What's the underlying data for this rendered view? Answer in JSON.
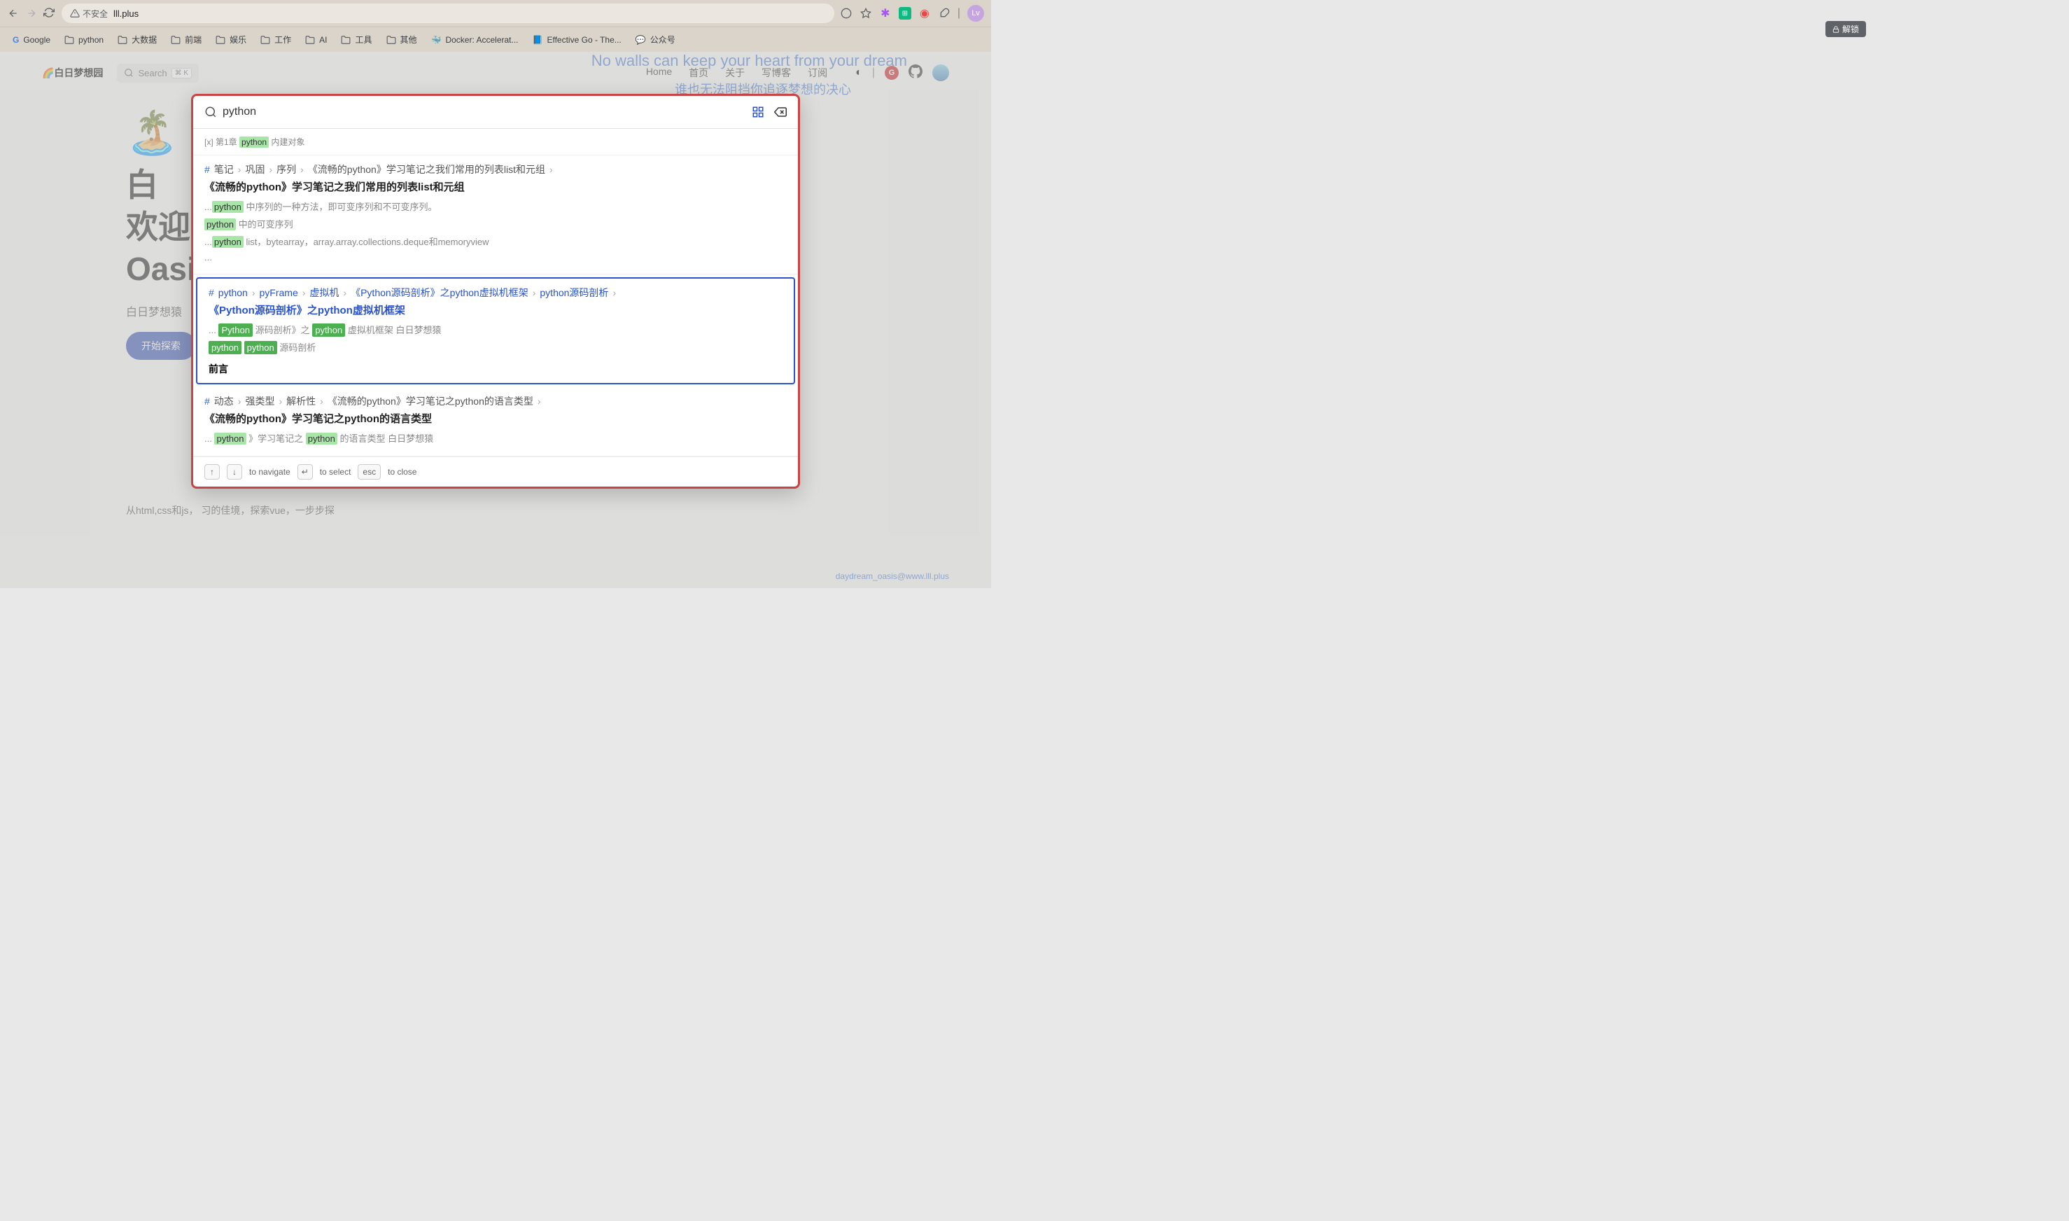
{
  "browser": {
    "insecure_label": "不安全",
    "url": "lll.plus",
    "lock_badge": "解锁",
    "avatar_letter": "Lv"
  },
  "bookmarks": [
    {
      "icon": "google",
      "label": "Google"
    },
    {
      "icon": "folder",
      "label": "python"
    },
    {
      "icon": "folder",
      "label": "大数据"
    },
    {
      "icon": "folder",
      "label": "前端"
    },
    {
      "icon": "folder",
      "label": "娱乐"
    },
    {
      "icon": "folder",
      "label": "工作"
    },
    {
      "icon": "folder",
      "label": "AI"
    },
    {
      "icon": "folder",
      "label": "工具"
    },
    {
      "icon": "folder",
      "label": "其他"
    },
    {
      "icon": "docker",
      "label": "Docker: Accelerat..."
    },
    {
      "icon": "gopher",
      "label": "Effective Go - The..."
    },
    {
      "icon": "wechat",
      "label": "公众号"
    }
  ],
  "nav": {
    "brand": "🌈白日梦想园",
    "search_label": "Search",
    "search_kbd": "⌘ K",
    "links": [
      "Home",
      "首页",
      "关于",
      "写博客",
      "订阅"
    ]
  },
  "hero": {
    "title_line1": "白",
    "title_line2": "欢迎",
    "title_line3": "Oasi",
    "subtitle": "白日梦想猿",
    "button": "开始探索"
  },
  "overlay_text": {
    "line1": "No walls can keep your heart from your dream",
    "line2": "谁也无法阻挡你追逐梦想的决心"
  },
  "body_paragraph": "从html,css和js，                                                                                                                                                                                                                                                     习的佳境，探索vue，一步步探",
  "footer_link": "daydream_oasis@www.lll.plus",
  "search_modal": {
    "query": "python",
    "results": [
      {
        "type": "compact",
        "prefix": "[x] 第1章",
        "highlight": "python",
        "suffix": "内建对象"
      },
      {
        "type": "full",
        "breadcrumb": [
          "笔记",
          "巩固",
          "序列",
          "《流畅的python》学习笔记之我们常用的列表list和元组"
        ],
        "title": "《流畅的python》学习笔记之我们常用的列表list和元组",
        "snippets": [
          {
            "prefix": "...",
            "hl": "python",
            "suffix": " 中序列的一种方法，即可变序列和不可变序列。"
          },
          {
            "prefix": "",
            "hl": "python",
            "suffix": " 中的可变序列"
          },
          {
            "prefix": "...",
            "hl": "python",
            "suffix": " list，bytearray，array.array.collections.deque和memoryview"
          },
          {
            "prefix": "...",
            "hl": "",
            "suffix": ""
          }
        ]
      },
      {
        "type": "full_active",
        "breadcrumb": [
          "python",
          "pyFrame",
          "虚拟机",
          "《Python源码剖析》之python虚拟机框架",
          "python源码剖析"
        ],
        "title": "《Python源码剖析》之python虚拟机框架",
        "snippets": [
          {
            "parts": [
              {
                "t": "..."
              },
              {
                "t": "Python",
                "g": true
              },
              {
                "t": " 源码剖析》之"
              },
              {
                "t": "python",
                "g": true
              },
              {
                "t": " 虚拟机框架 白日梦想猿"
              }
            ]
          },
          {
            "parts": [
              {
                "t": "python",
                "g": true
              },
              {
                "t": "  "
              },
              {
                "t": "python",
                "g": true
              },
              {
                "t": " 源码剖析"
              }
            ]
          }
        ],
        "footer": "前言"
      },
      {
        "type": "full",
        "breadcrumb": [
          "动态",
          "强类型",
          "解析性",
          "《流畅的python》学习笔记之python的语言类型"
        ],
        "title": "《流畅的python》学习笔记之python的语言类型",
        "snippets": [
          {
            "parts": [
              {
                "t": "..."
              },
              {
                "t": "python",
                "hl": true
              },
              {
                "t": " 》学习笔记之"
              },
              {
                "t": "python",
                "hl": true
              },
              {
                "t": " 的语言类型 白日梦想猿"
              }
            ]
          }
        ]
      }
    ],
    "footer": {
      "navigate": "to navigate",
      "select": "to select",
      "esc_key": "esc",
      "close": "to close"
    }
  }
}
